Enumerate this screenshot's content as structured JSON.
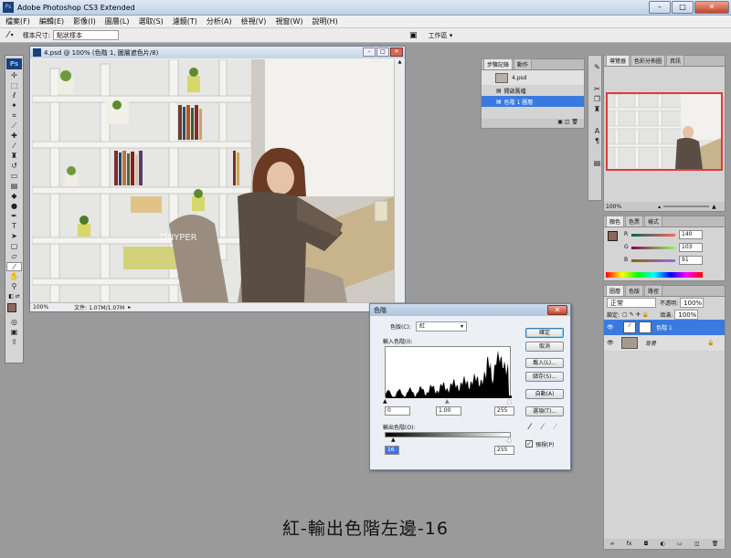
{
  "app": {
    "title": "Adobe Photoshop CS3 Extended",
    "logo": "Ps"
  },
  "menu": [
    "檔案(F)",
    "編輯(E)",
    "影像(I)",
    "圖層(L)",
    "選取(S)",
    "濾鏡(T)",
    "分析(A)",
    "檢視(V)",
    "視窗(W)",
    "說明(H)"
  ],
  "options": {
    "sample_size_label": "樣本尺寸:",
    "sample_size_value": "點狀樣本",
    "workspace_label": "工作區 ▾"
  },
  "document": {
    "title": "4.psd @ 100% (色階 1, 圖層遮色片/8)",
    "zoom": "100%",
    "doc_info": "文件: 1.07M/1.07M",
    "watermark": "DNYPER"
  },
  "history_panel": {
    "tabs": [
      "步驟記錄",
      "動作"
    ],
    "snapshot": "4.psd",
    "items": [
      "開啟舊檔",
      "色階 1 圖層"
    ]
  },
  "navigator_panel": {
    "tabs": [
      "導覽器",
      "色彩分佈圖",
      "資訊"
    ],
    "zoom": "100%"
  },
  "color_panel": {
    "tabs": [
      "顏色",
      "色票",
      "樣式"
    ],
    "r_label": "R",
    "g_label": "G",
    "b_label": "B",
    "r": "140",
    "g": "103",
    "b": "91",
    "r_value": 140,
    "g_value": 103,
    "b_value": 91,
    "fg_color": "#8c675b"
  },
  "layers_panel": {
    "tabs": [
      "圖層",
      "色版",
      "路徑"
    ],
    "blend_mode": "正常",
    "opacity_label": "不透明:",
    "opacity": "100%",
    "lock_label": "鎖定:",
    "fill_label": "填滿:",
    "fill": "100%",
    "layers": [
      {
        "name": "色階 1",
        "selected": true
      },
      {
        "name": "背景",
        "selected": false
      }
    ]
  },
  "levels_dialog": {
    "title": "色階",
    "channel_label": "色版(C):",
    "channel_value": "紅",
    "input_label": "輸入色階(I):",
    "input_black": "0",
    "input_gamma": "1.00",
    "input_white": "255",
    "output_label": "輸出色階(O):",
    "output_black": "16",
    "output_white": "255",
    "buttons": [
      "確定",
      "取消",
      "載入(L)...",
      "儲存(S)...",
      "自動(A)",
      "選項(T)..."
    ],
    "preview_label": "預視(P)",
    "preview_checked": true
  },
  "caption": "紅-輸出色階左邊-16"
}
